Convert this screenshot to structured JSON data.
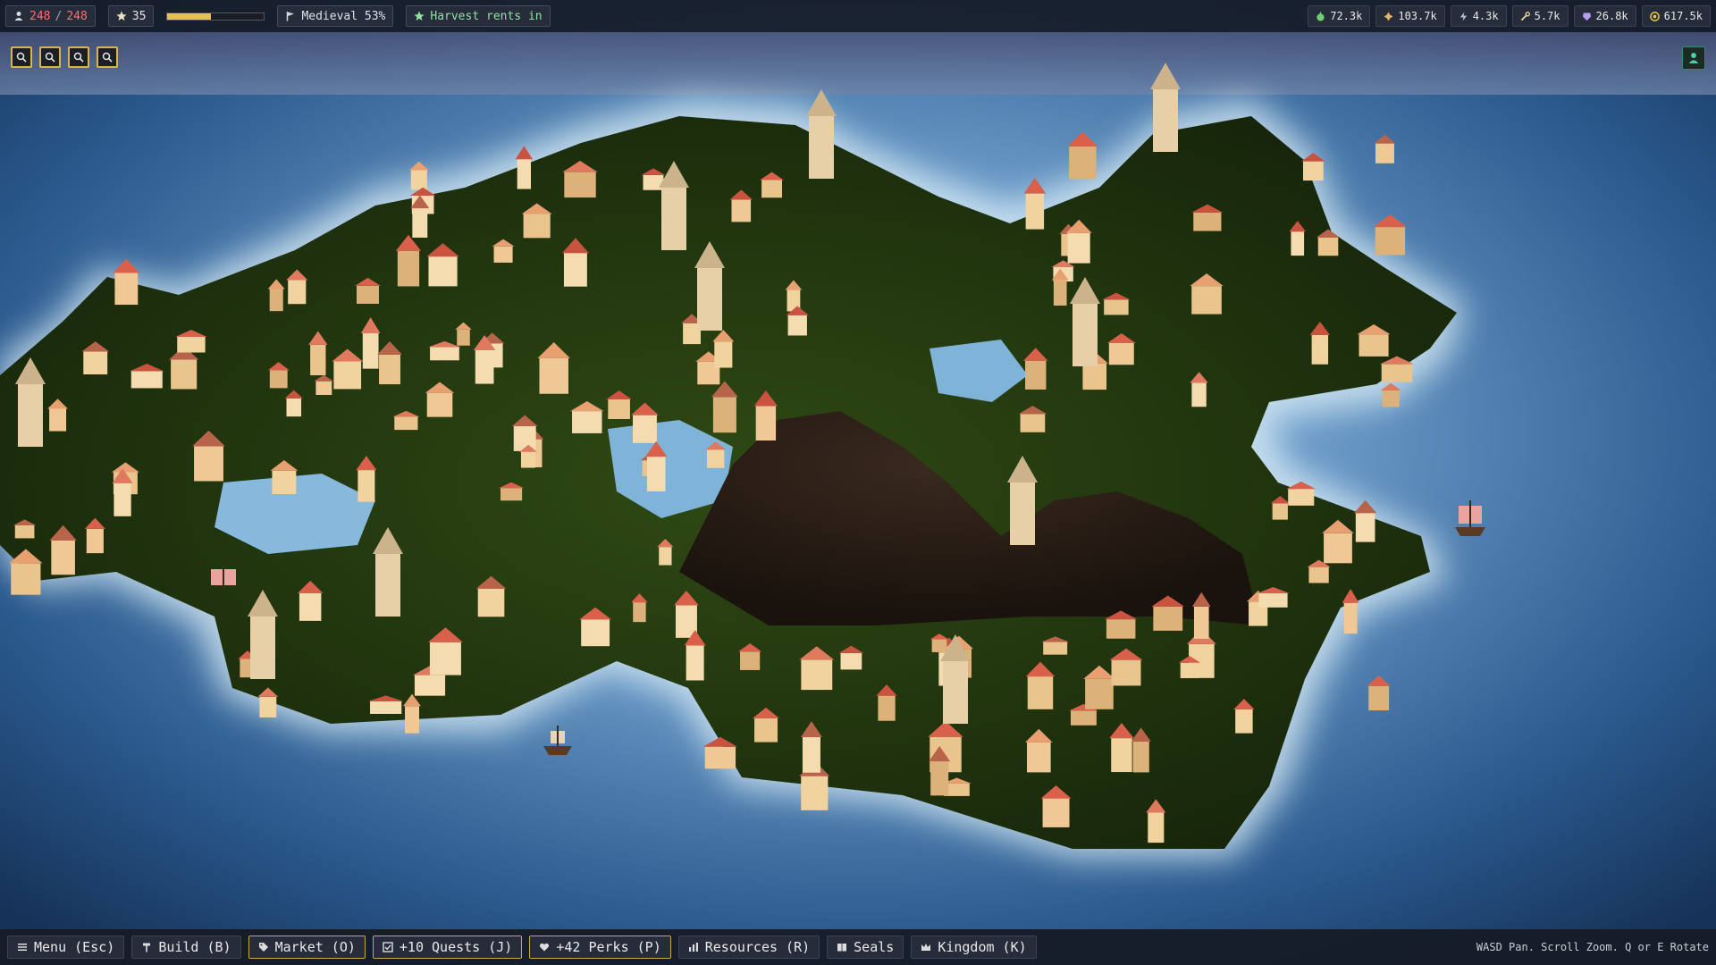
{
  "topbar": {
    "population": {
      "icon": "person-icon",
      "current": "248",
      "separator": "/",
      "max": "248"
    },
    "level": {
      "icon": "star-icon",
      "value": "35"
    },
    "xp_progress": 0.45,
    "era": {
      "icon": "flag-icon",
      "label": "Medieval 53%"
    },
    "objective": {
      "icon": "star-icon",
      "label": "Harvest rents in"
    },
    "resources": [
      {
        "icon": "food-icon",
        "value": "72.3k",
        "color": "#6dd36d"
      },
      {
        "icon": "wood-icon",
        "value": "103.7k",
        "color": "#e3b56b"
      },
      {
        "icon": "stone-icon",
        "value": "4.3k",
        "color": "#bfc6d1"
      },
      {
        "icon": "tools-icon",
        "value": "5.7k",
        "color": "#e8d59a"
      },
      {
        "icon": "gem-icon",
        "value": "26.8k",
        "color": "#b49cf5"
      },
      {
        "icon": "coin-icon",
        "value": "617.5k",
        "color": "#f2c94c"
      }
    ]
  },
  "camera_tools": [
    {
      "icon": "zoom-icon"
    },
    {
      "icon": "zoom-icon"
    },
    {
      "icon": "zoom-icon"
    },
    {
      "icon": "zoom-icon"
    }
  ],
  "profile": {
    "icon": "person-icon"
  },
  "bottombar": {
    "buttons": [
      {
        "icon": "menu-icon",
        "label": "Menu (Esc)"
      },
      {
        "icon": "hammer-icon",
        "label": "Build (B)"
      },
      {
        "icon": "tag-icon",
        "label": "Market (O)"
      },
      {
        "icon": "checkbox-icon",
        "label": "+10 Quests (J)"
      },
      {
        "icon": "heart-icon",
        "label": "+42 Perks (P)"
      },
      {
        "icon": "bar-chart-icon",
        "label": "Resources (R)"
      },
      {
        "icon": "book-icon",
        "label": "Seals"
      },
      {
        "icon": "crown-icon",
        "label": "Kingdom (K)"
      }
    ],
    "hint": "WASD Pan. Scroll Zoom. Q or E Rotate"
  },
  "colors": {
    "sea_deep": "#1a3a66",
    "sea_glow": "#8fbfe0",
    "grass": "#24380f",
    "mountain": "#211711",
    "accent": "#d8b44a"
  }
}
